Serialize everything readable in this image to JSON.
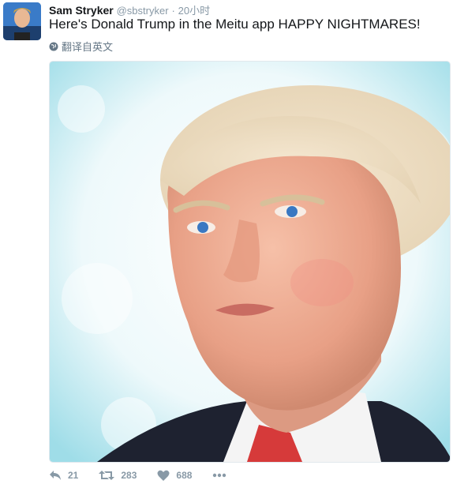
{
  "tweet": {
    "author_name": "Sam Stryker",
    "handle": "@sbstryker",
    "separator": "·",
    "time": "20小时",
    "text": "Here's Donald Trump in the Meitu app HAPPY NIGHTMARES!",
    "translate_label": "翻译自英文"
  },
  "actions": {
    "reply_count": "21",
    "retweet_count": "283",
    "like_count": "688"
  },
  "icons": {
    "reply": "reply-icon",
    "retweet": "retweet-icon",
    "like": "heart-icon",
    "more": "more-icon",
    "translate": "globe-icon"
  },
  "colors": {
    "text": "#14171a",
    "muted": "#8899a6",
    "border": "#e1e8ed"
  }
}
